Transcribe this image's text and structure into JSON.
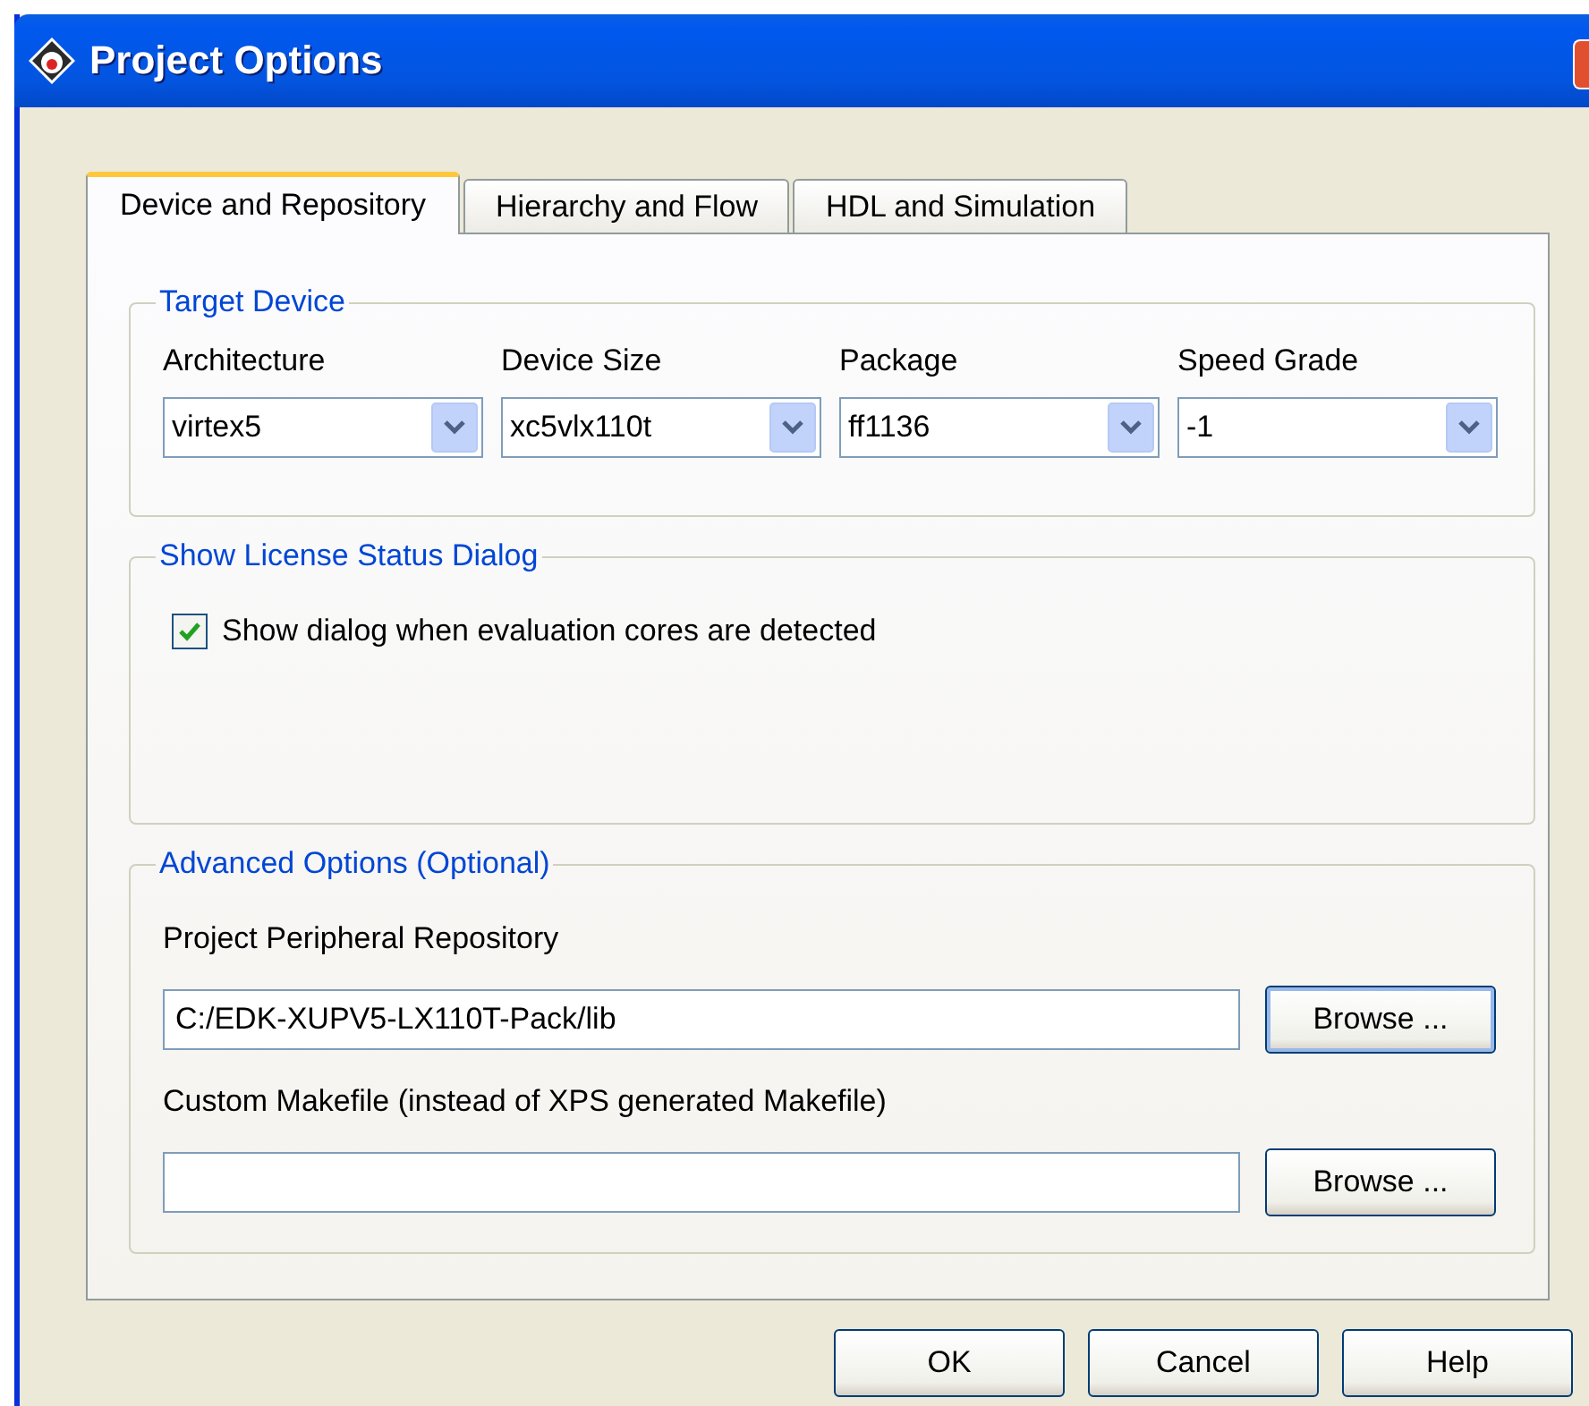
{
  "window": {
    "title": "Project Options"
  },
  "tabs": [
    {
      "label": "Device and Repository",
      "selected": true
    },
    {
      "label": "Hierarchy and Flow",
      "selected": false
    },
    {
      "label": "HDL and Simulation",
      "selected": false
    }
  ],
  "target_device": {
    "legend": "Target Device",
    "fields": [
      {
        "label": "Architecture",
        "value": "virtex5"
      },
      {
        "label": "Device Size",
        "value": "xc5vlx110t"
      },
      {
        "label": "Package",
        "value": "ff1136"
      },
      {
        "label": "Speed Grade",
        "value": "-1"
      }
    ]
  },
  "license": {
    "legend": "Show License Status Dialog",
    "checkbox": {
      "label": "Show dialog when evaluation cores are detected",
      "checked": true
    }
  },
  "advanced": {
    "legend": "Advanced Options (Optional)",
    "rows": [
      {
        "label": "Project Peripheral Repository",
        "value": "C:/EDK-XUPV5-LX110T-Pack/lib",
        "button": "Browse ...",
        "focused": true
      },
      {
        "label": "Custom Makefile (instead of XPS generated Makefile)",
        "button": "Browse ...",
        "focused": false
      }
    ]
  },
  "buttons": [
    "OK",
    "Cancel",
    "Help"
  ]
}
